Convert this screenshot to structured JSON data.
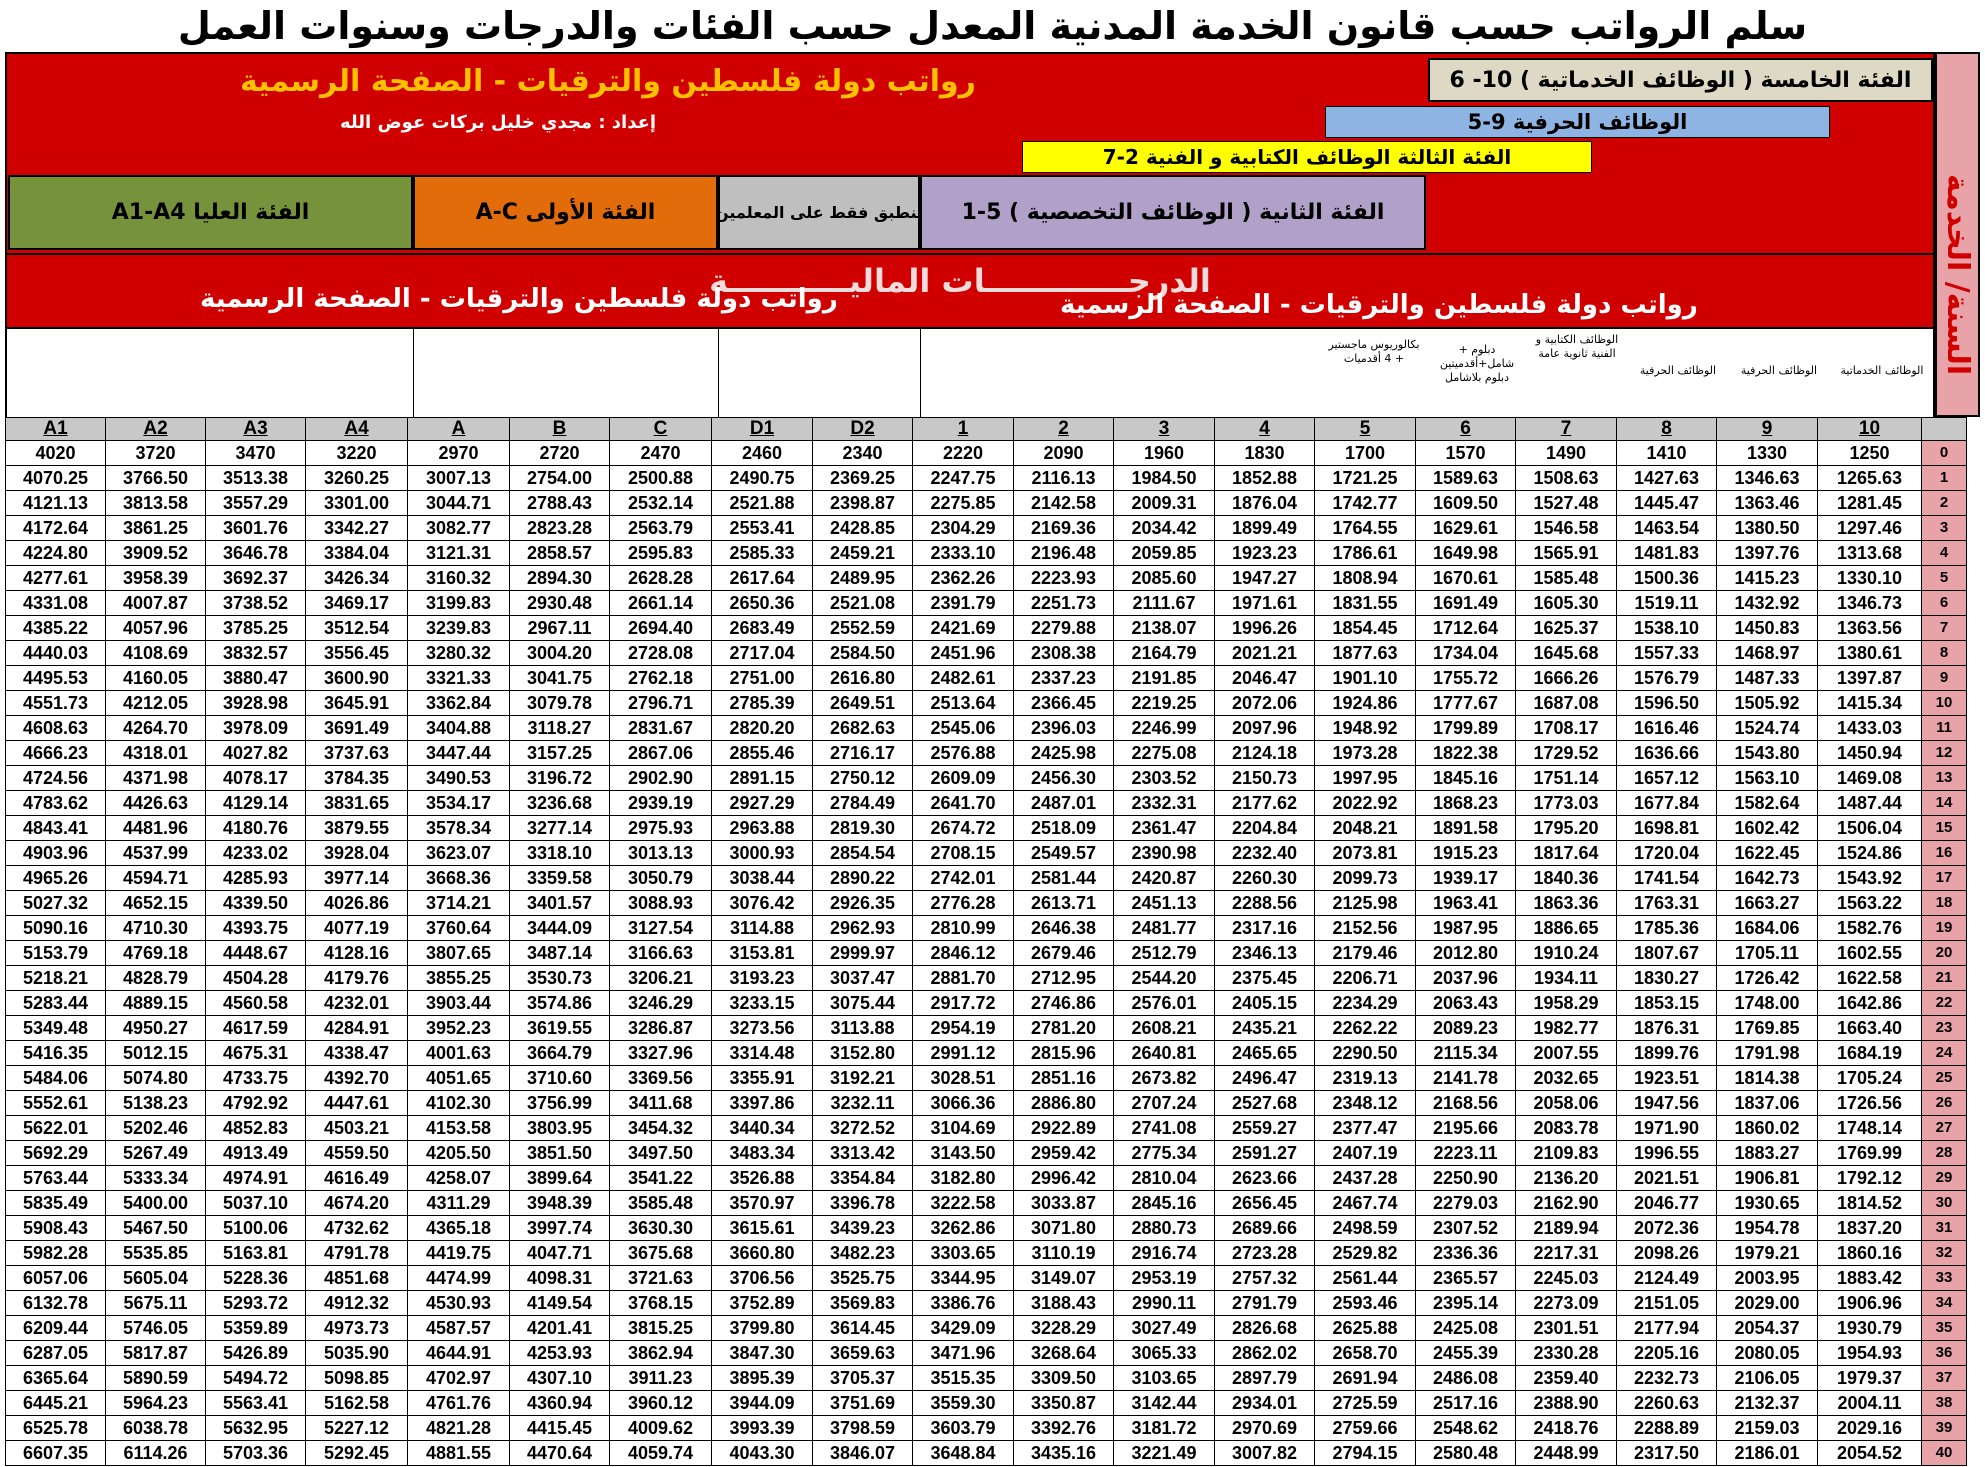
{
  "title": "سلم الرواتب حسب قانون الخدمة المدنية المعدل حسب الفئات والدرجات وسنوات العمل",
  "banner_top": "رواتب دولة فلسطين والترقيات - الصفحة الرسمية",
  "author": "إعداد : مجدي خليل بركات عوض الله",
  "cat5": "الفئة الخامسة ( الوظائف الخدماتية ) 10- 6",
  "craft": "الوظائف الحرفية   9-5",
  "cat3": "الفئة الثالثة الوظائف الكتابية و الفنية   2-7",
  "cat_top": "الفئة العليا A1-A4",
  "cat_first": "الفئة الأولى A-C",
  "teachers": "ينطبق فقط على المعلمين",
  "cat2": "الفئة الثانية ( الوظائف التخصصية ) 5-1",
  "degrees": "الدرجـــــــــــــات الماليـــــــــــة",
  "banner_mid_right": "رواتب دولة فلسطين والترقيات - الصفحة الرسمية",
  "banner_mid_left": "رواتب دولة فلسطين والترقيات - الصفحة الرسمية",
  "side_label": "السنة/ الخدمة",
  "descs": {
    "g5": "بكالوريوس ماجستير + 4 أقدميات",
    "g6": "دبلوم + شامل+أقدميتين دبلوم بلاشامل",
    "g7": "الوظائف الكتابية و الفنية ثانوية عامة",
    "g8": "الوظائف الحرفية",
    "g9": "الوظائف الحرفية",
    "g10": "الوظائف الخدماتية"
  },
  "grades": [
    "A1",
    "A2",
    "A3",
    "A4",
    "A",
    "B",
    "C",
    "D1",
    "D2",
    "1",
    "2",
    "3",
    "4",
    "5",
    "6",
    "7",
    "8",
    "9",
    "10"
  ],
  "rows": [
    [
      "4020",
      "3720",
      "3470",
      "3220",
      "2970",
      "2720",
      "2470",
      "2460",
      "2340",
      "2220",
      "2090",
      "1960",
      "1830",
      "1700",
      "1570",
      "1490",
      "1410",
      "1330",
      "1250",
      "0"
    ],
    [
      "4070.25",
      "3766.50",
      "3513.38",
      "3260.25",
      "3007.13",
      "2754.00",
      "2500.88",
      "2490.75",
      "2369.25",
      "2247.75",
      "2116.13",
      "1984.50",
      "1852.88",
      "1721.25",
      "1589.63",
      "1508.63",
      "1427.63",
      "1346.63",
      "1265.63",
      "1"
    ],
    [
      "4121.13",
      "3813.58",
      "3557.29",
      "3301.00",
      "3044.71",
      "2788.43",
      "2532.14",
      "2521.88",
      "2398.87",
      "2275.85",
      "2142.58",
      "2009.31",
      "1876.04",
      "1742.77",
      "1609.50",
      "1527.48",
      "1445.47",
      "1363.46",
      "1281.45",
      "2"
    ],
    [
      "4172.64",
      "3861.25",
      "3601.76",
      "3342.27",
      "3082.77",
      "2823.28",
      "2563.79",
      "2553.41",
      "2428.85",
      "2304.29",
      "2169.36",
      "2034.42",
      "1899.49",
      "1764.55",
      "1629.61",
      "1546.58",
      "1463.54",
      "1380.50",
      "1297.46",
      "3"
    ],
    [
      "4224.80",
      "3909.52",
      "3646.78",
      "3384.04",
      "3121.31",
      "2858.57",
      "2595.83",
      "2585.33",
      "2459.21",
      "2333.10",
      "2196.48",
      "2059.85",
      "1923.23",
      "1786.61",
      "1649.98",
      "1565.91",
      "1481.83",
      "1397.76",
      "1313.68",
      "4"
    ],
    [
      "4277.61",
      "3958.39",
      "3692.37",
      "3426.34",
      "3160.32",
      "2894.30",
      "2628.28",
      "2617.64",
      "2489.95",
      "2362.26",
      "2223.93",
      "2085.60",
      "1947.27",
      "1808.94",
      "1670.61",
      "1585.48",
      "1500.36",
      "1415.23",
      "1330.10",
      "5"
    ],
    [
      "4331.08",
      "4007.87",
      "3738.52",
      "3469.17",
      "3199.83",
      "2930.48",
      "2661.14",
      "2650.36",
      "2521.08",
      "2391.79",
      "2251.73",
      "2111.67",
      "1971.61",
      "1831.55",
      "1691.49",
      "1605.30",
      "1519.11",
      "1432.92",
      "1346.73",
      "6"
    ],
    [
      "4385.22",
      "4057.96",
      "3785.25",
      "3512.54",
      "3239.83",
      "2967.11",
      "2694.40",
      "2683.49",
      "2552.59",
      "2421.69",
      "2279.88",
      "2138.07",
      "1996.26",
      "1854.45",
      "1712.64",
      "1625.37",
      "1538.10",
      "1450.83",
      "1363.56",
      "7"
    ],
    [
      "4440.03",
      "4108.69",
      "3832.57",
      "3556.45",
      "3280.32",
      "3004.20",
      "2728.08",
      "2717.04",
      "2584.50",
      "2451.96",
      "2308.38",
      "2164.79",
      "2021.21",
      "1877.63",
      "1734.04",
      "1645.68",
      "1557.33",
      "1468.97",
      "1380.61",
      "8"
    ],
    [
      "4495.53",
      "4160.05",
      "3880.47",
      "3600.90",
      "3321.33",
      "3041.75",
      "2762.18",
      "2751.00",
      "2616.80",
      "2482.61",
      "2337.23",
      "2191.85",
      "2046.47",
      "1901.10",
      "1755.72",
      "1666.26",
      "1576.79",
      "1487.33",
      "1397.87",
      "9"
    ],
    [
      "4551.73",
      "4212.05",
      "3928.98",
      "3645.91",
      "3362.84",
      "3079.78",
      "2796.71",
      "2785.39",
      "2649.51",
      "2513.64",
      "2366.45",
      "2219.25",
      "2072.06",
      "1924.86",
      "1777.67",
      "1687.08",
      "1596.50",
      "1505.92",
      "1415.34",
      "10"
    ],
    [
      "4608.63",
      "4264.70",
      "3978.09",
      "3691.49",
      "3404.88",
      "3118.27",
      "2831.67",
      "2820.20",
      "2682.63",
      "2545.06",
      "2396.03",
      "2246.99",
      "2097.96",
      "1948.92",
      "1799.89",
      "1708.17",
      "1616.46",
      "1524.74",
      "1433.03",
      "11"
    ],
    [
      "4666.23",
      "4318.01",
      "4027.82",
      "3737.63",
      "3447.44",
      "3157.25",
      "2867.06",
      "2855.46",
      "2716.17",
      "2576.88",
      "2425.98",
      "2275.08",
      "2124.18",
      "1973.28",
      "1822.38",
      "1729.52",
      "1636.66",
      "1543.80",
      "1450.94",
      "12"
    ],
    [
      "4724.56",
      "4371.98",
      "4078.17",
      "3784.35",
      "3490.53",
      "3196.72",
      "2902.90",
      "2891.15",
      "2750.12",
      "2609.09",
      "2456.30",
      "2303.52",
      "2150.73",
      "1997.95",
      "1845.16",
      "1751.14",
      "1657.12",
      "1563.10",
      "1469.08",
      "13"
    ],
    [
      "4783.62",
      "4426.63",
      "4129.14",
      "3831.65",
      "3534.17",
      "3236.68",
      "2939.19",
      "2927.29",
      "2784.49",
      "2641.70",
      "2487.01",
      "2332.31",
      "2177.62",
      "2022.92",
      "1868.23",
      "1773.03",
      "1677.84",
      "1582.64",
      "1487.44",
      "14"
    ],
    [
      "4843.41",
      "4481.96",
      "4180.76",
      "3879.55",
      "3578.34",
      "3277.14",
      "2975.93",
      "2963.88",
      "2819.30",
      "2674.72",
      "2518.09",
      "2361.47",
      "2204.84",
      "2048.21",
      "1891.58",
      "1795.20",
      "1698.81",
      "1602.42",
      "1506.04",
      "15"
    ],
    [
      "4903.96",
      "4537.99",
      "4233.02",
      "3928.04",
      "3623.07",
      "3318.10",
      "3013.13",
      "3000.93",
      "2854.54",
      "2708.15",
      "2549.57",
      "2390.98",
      "2232.40",
      "2073.81",
      "1915.23",
      "1817.64",
      "1720.04",
      "1622.45",
      "1524.86",
      "16"
    ],
    [
      "4965.26",
      "4594.71",
      "4285.93",
      "3977.14",
      "3668.36",
      "3359.58",
      "3050.79",
      "3038.44",
      "2890.22",
      "2742.01",
      "2581.44",
      "2420.87",
      "2260.30",
      "2099.73",
      "1939.17",
      "1840.36",
      "1741.54",
      "1642.73",
      "1543.92",
      "17"
    ],
    [
      "5027.32",
      "4652.15",
      "4339.50",
      "4026.86",
      "3714.21",
      "3401.57",
      "3088.93",
      "3076.42",
      "2926.35",
      "2776.28",
      "2613.71",
      "2451.13",
      "2288.56",
      "2125.98",
      "1963.41",
      "1863.36",
      "1763.31",
      "1663.27",
      "1563.22",
      "18"
    ],
    [
      "5090.16",
      "4710.30",
      "4393.75",
      "4077.19",
      "3760.64",
      "3444.09",
      "3127.54",
      "3114.88",
      "2962.93",
      "2810.99",
      "2646.38",
      "2481.77",
      "2317.16",
      "2152.56",
      "1987.95",
      "1886.65",
      "1785.36",
      "1684.06",
      "1582.76",
      "19"
    ],
    [
      "5153.79",
      "4769.18",
      "4448.67",
      "4128.16",
      "3807.65",
      "3487.14",
      "3166.63",
      "3153.81",
      "2999.97",
      "2846.12",
      "2679.46",
      "2512.79",
      "2346.13",
      "2179.46",
      "2012.80",
      "1910.24",
      "1807.67",
      "1705.11",
      "1602.55",
      "20"
    ],
    [
      "5218.21",
      "4828.79",
      "4504.28",
      "4179.76",
      "3855.25",
      "3530.73",
      "3206.21",
      "3193.23",
      "3037.47",
      "2881.70",
      "2712.95",
      "2544.20",
      "2375.45",
      "2206.71",
      "2037.96",
      "1934.11",
      "1830.27",
      "1726.42",
      "1622.58",
      "21"
    ],
    [
      "5283.44",
      "4889.15",
      "4560.58",
      "4232.01",
      "3903.44",
      "3574.86",
      "3246.29",
      "3233.15",
      "3075.44",
      "2917.72",
      "2746.86",
      "2576.01",
      "2405.15",
      "2234.29",
      "2063.43",
      "1958.29",
      "1853.15",
      "1748.00",
      "1642.86",
      "22"
    ],
    [
      "5349.48",
      "4950.27",
      "4617.59",
      "4284.91",
      "3952.23",
      "3619.55",
      "3286.87",
      "3273.56",
      "3113.88",
      "2954.19",
      "2781.20",
      "2608.21",
      "2435.21",
      "2262.22",
      "2089.23",
      "1982.77",
      "1876.31",
      "1769.85",
      "1663.40",
      "23"
    ],
    [
      "5416.35",
      "5012.15",
      "4675.31",
      "4338.47",
      "4001.63",
      "3664.79",
      "3327.96",
      "3314.48",
      "3152.80",
      "2991.12",
      "2815.96",
      "2640.81",
      "2465.65",
      "2290.50",
      "2115.34",
      "2007.55",
      "1899.76",
      "1791.98",
      "1684.19",
      "24"
    ],
    [
      "5484.06",
      "5074.80",
      "4733.75",
      "4392.70",
      "4051.65",
      "3710.60",
      "3369.56",
      "3355.91",
      "3192.21",
      "3028.51",
      "2851.16",
      "2673.82",
      "2496.47",
      "2319.13",
      "2141.78",
      "2032.65",
      "1923.51",
      "1814.38",
      "1705.24",
      "25"
    ],
    [
      "5552.61",
      "5138.23",
      "4792.92",
      "4447.61",
      "4102.30",
      "3756.99",
      "3411.68",
      "3397.86",
      "3232.11",
      "3066.36",
      "2886.80",
      "2707.24",
      "2527.68",
      "2348.12",
      "2168.56",
      "2058.06",
      "1947.56",
      "1837.06",
      "1726.56",
      "26"
    ],
    [
      "5622.01",
      "5202.46",
      "4852.83",
      "4503.21",
      "4153.58",
      "3803.95",
      "3454.32",
      "3440.34",
      "3272.52",
      "3104.69",
      "2922.89",
      "2741.08",
      "2559.27",
      "2377.47",
      "2195.66",
      "2083.78",
      "1971.90",
      "1860.02",
      "1748.14",
      "27"
    ],
    [
      "5692.29",
      "5267.49",
      "4913.49",
      "4559.50",
      "4205.50",
      "3851.50",
      "3497.50",
      "3483.34",
      "3313.42",
      "3143.50",
      "2959.42",
      "2775.34",
      "2591.27",
      "2407.19",
      "2223.11",
      "2109.83",
      "1996.55",
      "1883.27",
      "1769.99",
      "28"
    ],
    [
      "5763.44",
      "5333.34",
      "4974.91",
      "4616.49",
      "4258.07",
      "3899.64",
      "3541.22",
      "3526.88",
      "3354.84",
      "3182.80",
      "2996.42",
      "2810.04",
      "2623.66",
      "2437.28",
      "2250.90",
      "2136.20",
      "2021.51",
      "1906.81",
      "1792.12",
      "29"
    ],
    [
      "5835.49",
      "5400.00",
      "5037.10",
      "4674.20",
      "4311.29",
      "3948.39",
      "3585.48",
      "3570.97",
      "3396.78",
      "3222.58",
      "3033.87",
      "2845.16",
      "2656.45",
      "2467.74",
      "2279.03",
      "2162.90",
      "2046.77",
      "1930.65",
      "1814.52",
      "30"
    ],
    [
      "5908.43",
      "5467.50",
      "5100.06",
      "4732.62",
      "4365.18",
      "3997.74",
      "3630.30",
      "3615.61",
      "3439.23",
      "3262.86",
      "3071.80",
      "2880.73",
      "2689.66",
      "2498.59",
      "2307.52",
      "2189.94",
      "2072.36",
      "1954.78",
      "1837.20",
      "31"
    ],
    [
      "5982.28",
      "5535.85",
      "5163.81",
      "4791.78",
      "4419.75",
      "4047.71",
      "3675.68",
      "3660.80",
      "3482.23",
      "3303.65",
      "3110.19",
      "2916.74",
      "2723.28",
      "2529.82",
      "2336.36",
      "2217.31",
      "2098.26",
      "1979.21",
      "1860.16",
      "32"
    ],
    [
      "6057.06",
      "5605.04",
      "5228.36",
      "4851.68",
      "4474.99",
      "4098.31",
      "3721.63",
      "3706.56",
      "3525.75",
      "3344.95",
      "3149.07",
      "2953.19",
      "2757.32",
      "2561.44",
      "2365.57",
      "2245.03",
      "2124.49",
      "2003.95",
      "1883.42",
      "33"
    ],
    [
      "6132.78",
      "5675.11",
      "5293.72",
      "4912.32",
      "4530.93",
      "4149.54",
      "3768.15",
      "3752.89",
      "3569.83",
      "3386.76",
      "3188.43",
      "2990.11",
      "2791.79",
      "2593.46",
      "2395.14",
      "2273.09",
      "2151.05",
      "2029.00",
      "1906.96",
      "34"
    ],
    [
      "6209.44",
      "5746.05",
      "5359.89",
      "4973.73",
      "4587.57",
      "4201.41",
      "3815.25",
      "3799.80",
      "3614.45",
      "3429.09",
      "3228.29",
      "3027.49",
      "2826.68",
      "2625.88",
      "2425.08",
      "2301.51",
      "2177.94",
      "2054.37",
      "1930.79",
      "35"
    ],
    [
      "6287.05",
      "5817.87",
      "5426.89",
      "5035.90",
      "4644.91",
      "4253.93",
      "3862.94",
      "3847.30",
      "3659.63",
      "3471.96",
      "3268.64",
      "3065.33",
      "2862.02",
      "2658.70",
      "2455.39",
      "2330.28",
      "2205.16",
      "2080.05",
      "1954.93",
      "36"
    ],
    [
      "6365.64",
      "5890.59",
      "5494.72",
      "5098.85",
      "4702.97",
      "4307.10",
      "3911.23",
      "3895.39",
      "3705.37",
      "3515.35",
      "3309.50",
      "3103.65",
      "2897.79",
      "2691.94",
      "2486.08",
      "2359.40",
      "2232.73",
      "2106.05",
      "1979.37",
      "37"
    ],
    [
      "6445.21",
      "5964.23",
      "5563.41",
      "5162.58",
      "4761.76",
      "4360.94",
      "3960.12",
      "3944.09",
      "3751.69",
      "3559.30",
      "3350.87",
      "3142.44",
      "2934.01",
      "2725.59",
      "2517.16",
      "2388.90",
      "2260.63",
      "2132.37",
      "2004.11",
      "38"
    ],
    [
      "6525.78",
      "6038.78",
      "5632.95",
      "5227.12",
      "4821.28",
      "4415.45",
      "4009.62",
      "3993.39",
      "3798.59",
      "3603.79",
      "3392.76",
      "3181.72",
      "2970.69",
      "2759.66",
      "2548.62",
      "2418.76",
      "2288.89",
      "2159.03",
      "2029.16",
      "39"
    ],
    [
      "6607.35",
      "6114.26",
      "5703.36",
      "5292.45",
      "4881.55",
      "4470.64",
      "4059.74",
      "4043.30",
      "3846.07",
      "3648.84",
      "3435.16",
      "3221.49",
      "3007.82",
      "2794.15",
      "2580.48",
      "2448.99",
      "2317.50",
      "2186.01",
      "2054.52",
      "40"
    ]
  ],
  "colors": {
    "red": "#d10000",
    "green": "#76933c",
    "orange": "#e26b0a",
    "gray": "#bfbfbf",
    "purple": "#b1a0c7",
    "tan": "#ddd9c4",
    "blue": "#8db4e2",
    "yellow": "#ffff00",
    "pink": "#e8a3a8",
    "title_gold": "#ffc000"
  }
}
